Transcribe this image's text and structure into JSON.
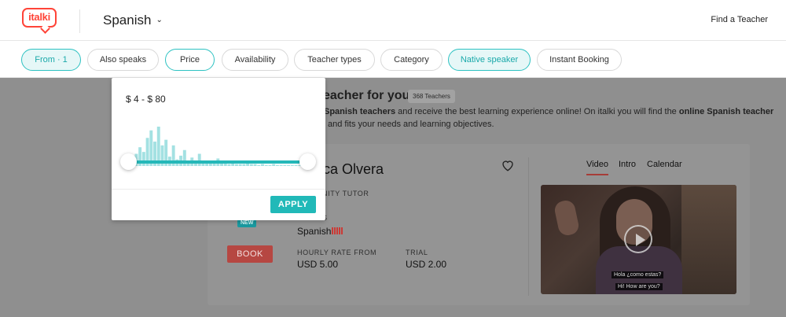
{
  "header": {
    "logo_text": "italki",
    "language": "Spanish",
    "find_teacher": "Find a Teacher"
  },
  "filters": [
    {
      "label": "From · 1",
      "active": true
    },
    {
      "label": "Also speaks",
      "active": false
    },
    {
      "label": "Price",
      "active": false,
      "open": true
    },
    {
      "label": "Availability",
      "active": false
    },
    {
      "label": "Teacher types",
      "active": false
    },
    {
      "label": "Category",
      "active": false
    },
    {
      "label": "Native speaker",
      "active": true
    },
    {
      "label": "Instant Booking",
      "active": false
    }
  ],
  "price_popover": {
    "range_text": "$ 4 - $ 80",
    "min": 4,
    "max": 80,
    "apply_label": "APPLY",
    "histogram": [
      4,
      8,
      13,
      20,
      15,
      30,
      38,
      26,
      42,
      22,
      28,
      10,
      22,
      7,
      11,
      17,
      5,
      9,
      6,
      13,
      4,
      3,
      5,
      3,
      8,
      3,
      4,
      2,
      3,
      2,
      2,
      2,
      3,
      2,
      2,
      1,
      2,
      1,
      1,
      2,
      1,
      1,
      1,
      1,
      1,
      1,
      1
    ]
  },
  "intro": {
    "title": "eacher for you.",
    "count_badge": "368 Teachers",
    "line1_a": "Spanish teachers",
    "line1_b": " and receive the best learning experience online! On italki you will find the ",
    "line1_c": "online Spanish teacher",
    "line2": "and fits your needs and learning objectives."
  },
  "teacher": {
    "name": "ca Olvera",
    "tutor_type": "NITY TUTOR",
    "speaks_label": "S",
    "new_badge": "NEW",
    "speaks_language": "Spanish",
    "book_label": "BOOK",
    "hourly_rate_label": "HOURLY RATE FROM",
    "hourly_rate_value": "USD 5.00",
    "trial_label": "TRIAL",
    "trial_value": "USD 2.00",
    "level_color": "#cc3a35"
  },
  "media": {
    "tabs": [
      "Video",
      "Intro",
      "Calendar"
    ],
    "active_tab": "Video",
    "subtitle_es": "Hola ¿como estas?",
    "subtitle_en": "Hi! How are you?"
  },
  "colors": {
    "brand": "#ff4438",
    "accent": "#21b9b8",
    "book": "#b64742"
  }
}
